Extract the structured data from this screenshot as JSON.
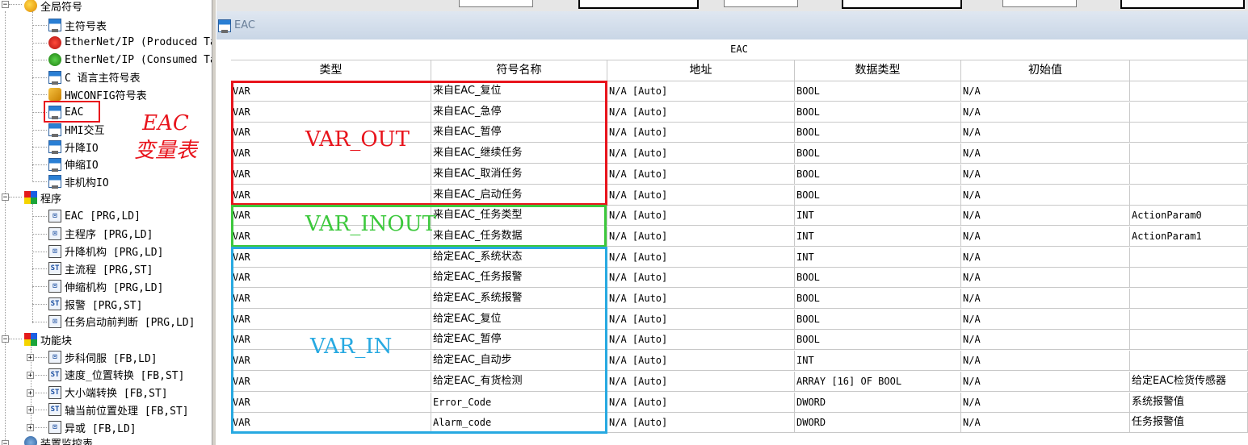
{
  "tree": {
    "root_label": "全局符号",
    "items": [
      {
        "label": "主符号表",
        "icon": "symbol-table-icon"
      },
      {
        "label": "EtherNet/IP (Produced Ta",
        "icon": "ethernet-ip-produced-icon"
      },
      {
        "label": "EtherNet/IP (Consumed Ta",
        "icon": "ethernet-ip-consumed-icon"
      },
      {
        "label": "C 语言主符号表",
        "icon": "symbol-table-icon"
      },
      {
        "label": "HWCONFIG符号表",
        "icon": "hwconfig-icon"
      },
      {
        "label": "EAC",
        "icon": "symbol-table-icon"
      },
      {
        "label": "HMI交互",
        "icon": "symbol-table-icon"
      },
      {
        "label": "升降IO",
        "icon": "symbol-table-icon"
      },
      {
        "label": "伸缩IO",
        "icon": "symbol-table-icon"
      },
      {
        "label": "非机构IO",
        "icon": "symbol-table-icon"
      }
    ],
    "program_label": "程序",
    "programs": [
      {
        "label": "EAC [PRG,LD]",
        "kind": "LD"
      },
      {
        "label": "主程序 [PRG,LD]",
        "kind": "LD"
      },
      {
        "label": "升降机构 [PRG,LD]",
        "kind": "LD"
      },
      {
        "label": "主流程 [PRG,ST]",
        "kind": "ST"
      },
      {
        "label": "伸缩机构 [PRG,LD]",
        "kind": "LD"
      },
      {
        "label": "报警 [PRG,ST]",
        "kind": "ST"
      },
      {
        "label": "任务启动前判断 [PRG,LD]",
        "kind": "LD"
      }
    ],
    "fb_label": "功能块",
    "function_blocks": [
      {
        "label": "步科伺服 [FB,LD]",
        "kind": "LD"
      },
      {
        "label": "速度_位置转换 [FB,ST]",
        "kind": "ST"
      },
      {
        "label": "大小端转换 [FB,ST]",
        "kind": "ST"
      },
      {
        "label": "轴当前位置处理 [FB,ST]",
        "kind": "ST"
      },
      {
        "label": "异或 [FB,LD]",
        "kind": "LD"
      }
    ],
    "last_label": "装置监控表",
    "annotation_line1": "EAC",
    "annotation_line2": "变量表"
  },
  "document": {
    "tab_title": "EAC",
    "group_header": "EAC",
    "columns": [
      "类型",
      "符号名称",
      "地址",
      "数据类型",
      "初始值",
      ""
    ],
    "rows": [
      [
        "VAR",
        "来自EAC_复位",
        "N/A [Auto]",
        "BOOL",
        "N/A",
        ""
      ],
      [
        "VAR",
        "来自EAC_急停",
        "N/A [Auto]",
        "BOOL",
        "N/A",
        ""
      ],
      [
        "VAR",
        "来自EAC_暂停",
        "N/A [Auto]",
        "BOOL",
        "N/A",
        ""
      ],
      [
        "VAR",
        "来自EAC_继续任务",
        "N/A [Auto]",
        "BOOL",
        "N/A",
        ""
      ],
      [
        "VAR",
        "来自EAC_取消任务",
        "N/A [Auto]",
        "BOOL",
        "N/A",
        ""
      ],
      [
        "VAR",
        "来自EAC_启动任务",
        "N/A [Auto]",
        "BOOL",
        "N/A",
        ""
      ],
      [
        "VAR",
        "来自EAC_任务类型",
        "N/A [Auto]",
        "INT",
        "N/A",
        "ActionParam0"
      ],
      [
        "VAR",
        "来自EAC_任务数据",
        "N/A [Auto]",
        "INT",
        "N/A",
        "ActionParam1"
      ],
      [
        "VAR",
        "给定EAC_系统状态",
        "N/A [Auto]",
        "INT",
        "N/A",
        ""
      ],
      [
        "VAR",
        "给定EAC_任务报警",
        "N/A [Auto]",
        "BOOL",
        "N/A",
        ""
      ],
      [
        "VAR",
        "给定EAC_系统报警",
        "N/A [Auto]",
        "BOOL",
        "N/A",
        ""
      ],
      [
        "VAR",
        "给定EAC_复位",
        "N/A [Auto]",
        "BOOL",
        "N/A",
        ""
      ],
      [
        "VAR",
        "给定EAC_暂停",
        "N/A [Auto]",
        "BOOL",
        "N/A",
        ""
      ],
      [
        "VAR",
        "给定EAC_自动步",
        "N/A [Auto]",
        "INT",
        "N/A",
        ""
      ],
      [
        "VAR",
        "给定EAC_有货检测",
        "N/A [Auto]",
        "ARRAY [16] OF BOOL",
        "N/A",
        "给定EAC检货传感器"
      ],
      [
        "VAR",
        "Error_Code",
        "N/A [Auto]",
        "DWORD",
        "N/A",
        "系统报警值"
      ],
      [
        "VAR",
        "Alarm_code",
        "N/A [Auto]",
        "DWORD",
        "N/A",
        "任务报警值"
      ]
    ],
    "groups": [
      {
        "label": "VAR_OUT",
        "color": "#e8141c",
        "first_row": 0,
        "last_row": 5
      },
      {
        "label": "VAR_INOUT",
        "color": "#3cc83c",
        "first_row": 6,
        "last_row": 7
      },
      {
        "label": "VAR_IN",
        "color": "#27a9e1",
        "first_row": 8,
        "last_row": 16
      }
    ]
  }
}
